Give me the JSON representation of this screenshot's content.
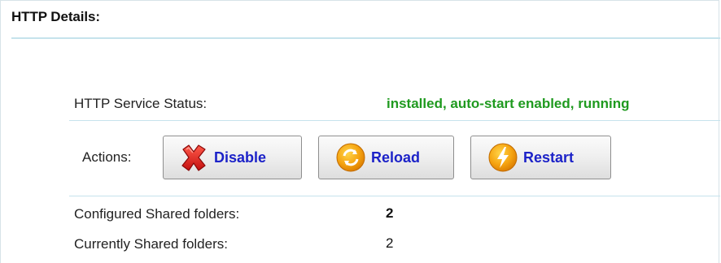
{
  "section": {
    "title": "HTTP Details:"
  },
  "status": {
    "label": "HTTP Service Status:",
    "value": "installed, auto-start enabled, running",
    "value_color": "#1f9a1f"
  },
  "actions": {
    "label": "Actions:",
    "buttons": [
      {
        "label": "Disable",
        "icon": "red-x-icon"
      },
      {
        "label": "Reload",
        "icon": "reload-icon"
      },
      {
        "label": "Restart",
        "icon": "lightning-icon"
      }
    ],
    "button_text_color": "#1c22c8"
  },
  "folders": {
    "configured_label": "Configured Shared folders:",
    "configured_value": "2",
    "current_label": "Currently Shared folders:",
    "current_value": "2"
  }
}
